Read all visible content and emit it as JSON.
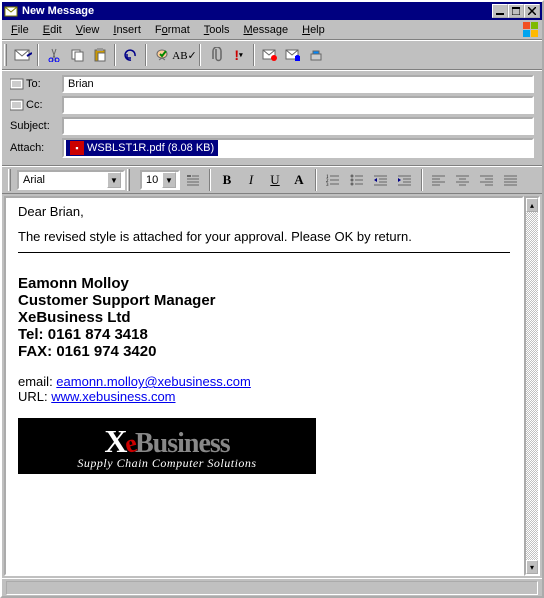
{
  "window": {
    "title": "New Message"
  },
  "menu": {
    "file": "File",
    "edit": "Edit",
    "view": "View",
    "insert": "Insert",
    "format": "Format",
    "tools": "Tools",
    "message": "Message",
    "help": "Help"
  },
  "fields": {
    "to_label": "To:",
    "to_value": "Brian",
    "cc_label": "Cc:",
    "cc_value": "",
    "subject_label": "Subject:",
    "subject_value": "",
    "attach_label": "Attach:",
    "attach_file": "WSBLST1R.pdf (8.08 KB)"
  },
  "format": {
    "font": "Arial",
    "size": "10",
    "bold": "B",
    "italic": "I",
    "underline": "U",
    "color": "A"
  },
  "body": {
    "greeting": "Dear Brian,",
    "para1": "The revised style is attached for your approval.  Please OK by return.",
    "sig_name": "Eamonn Molloy",
    "sig_title": "Customer Support Manager",
    "sig_company": "XeBusiness Ltd",
    "sig_tel": "Tel: 0161 874 3418",
    "sig_fax": "FAX: 0161 974 3420",
    "email_prefix": "email: ",
    "email_link": "eamonn.molloy@xebusiness.com",
    "url_prefix": "URL: ",
    "url_link": "www.xebusiness.com",
    "logo_x": "X",
    "logo_e": "e",
    "logo_rest": "Business",
    "logo_tagline": "Supply Chain Computer Solutions"
  }
}
